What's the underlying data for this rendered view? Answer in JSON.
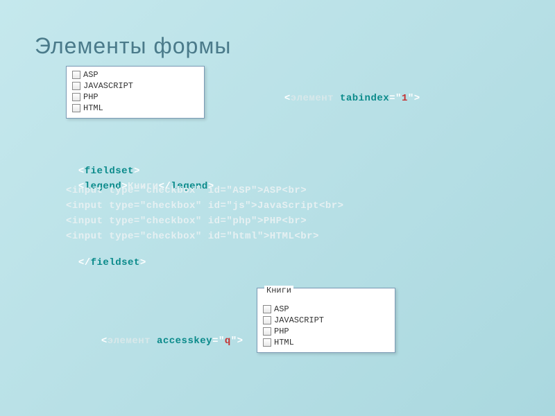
{
  "title": "Элементы формы",
  "box1": {
    "items": [
      "ASP",
      "JavaScript",
      "PHP",
      "HTML"
    ]
  },
  "box2": {
    "legend": "Книги",
    "items": [
      "ASP",
      "JavaScript",
      "PHP",
      "HTML"
    ]
  },
  "tabindex_line": {
    "lt": "<",
    "elem": "элемент ",
    "attr": "tabindex",
    "eq": "=\"",
    "val": "1",
    "close": "\">"
  },
  "code": {
    "l1": {
      "lt": "<",
      "tag": "fieldset",
      "gt": ">"
    },
    "l2": {
      "lt": "<",
      "tag1": "legend",
      "gt1": ">",
      "txt": "Книги",
      "lt2": "</",
      "tag2": "legend",
      "gt2": ">"
    },
    "l3": "<input type=\"checkbox\" id=\"ASP\">ASP<br>",
    "l4": "<input type=\"checkbox\" id=\"js\">JavaScript<br>",
    "l5": "<input type=\"checkbox\" id=\"php\">PHP<br>",
    "l6": "<input type=\"checkbox\" id=\"html\">HTML<br>",
    "l7": {
      "lt": "</",
      "tag": "fieldset",
      "gt": ">"
    }
  },
  "accesskey_line": {
    "lt": "<",
    "elem": "элемент ",
    "attr": "accesskey",
    "eq": "=\"",
    "val": "q",
    "close": "\">"
  }
}
